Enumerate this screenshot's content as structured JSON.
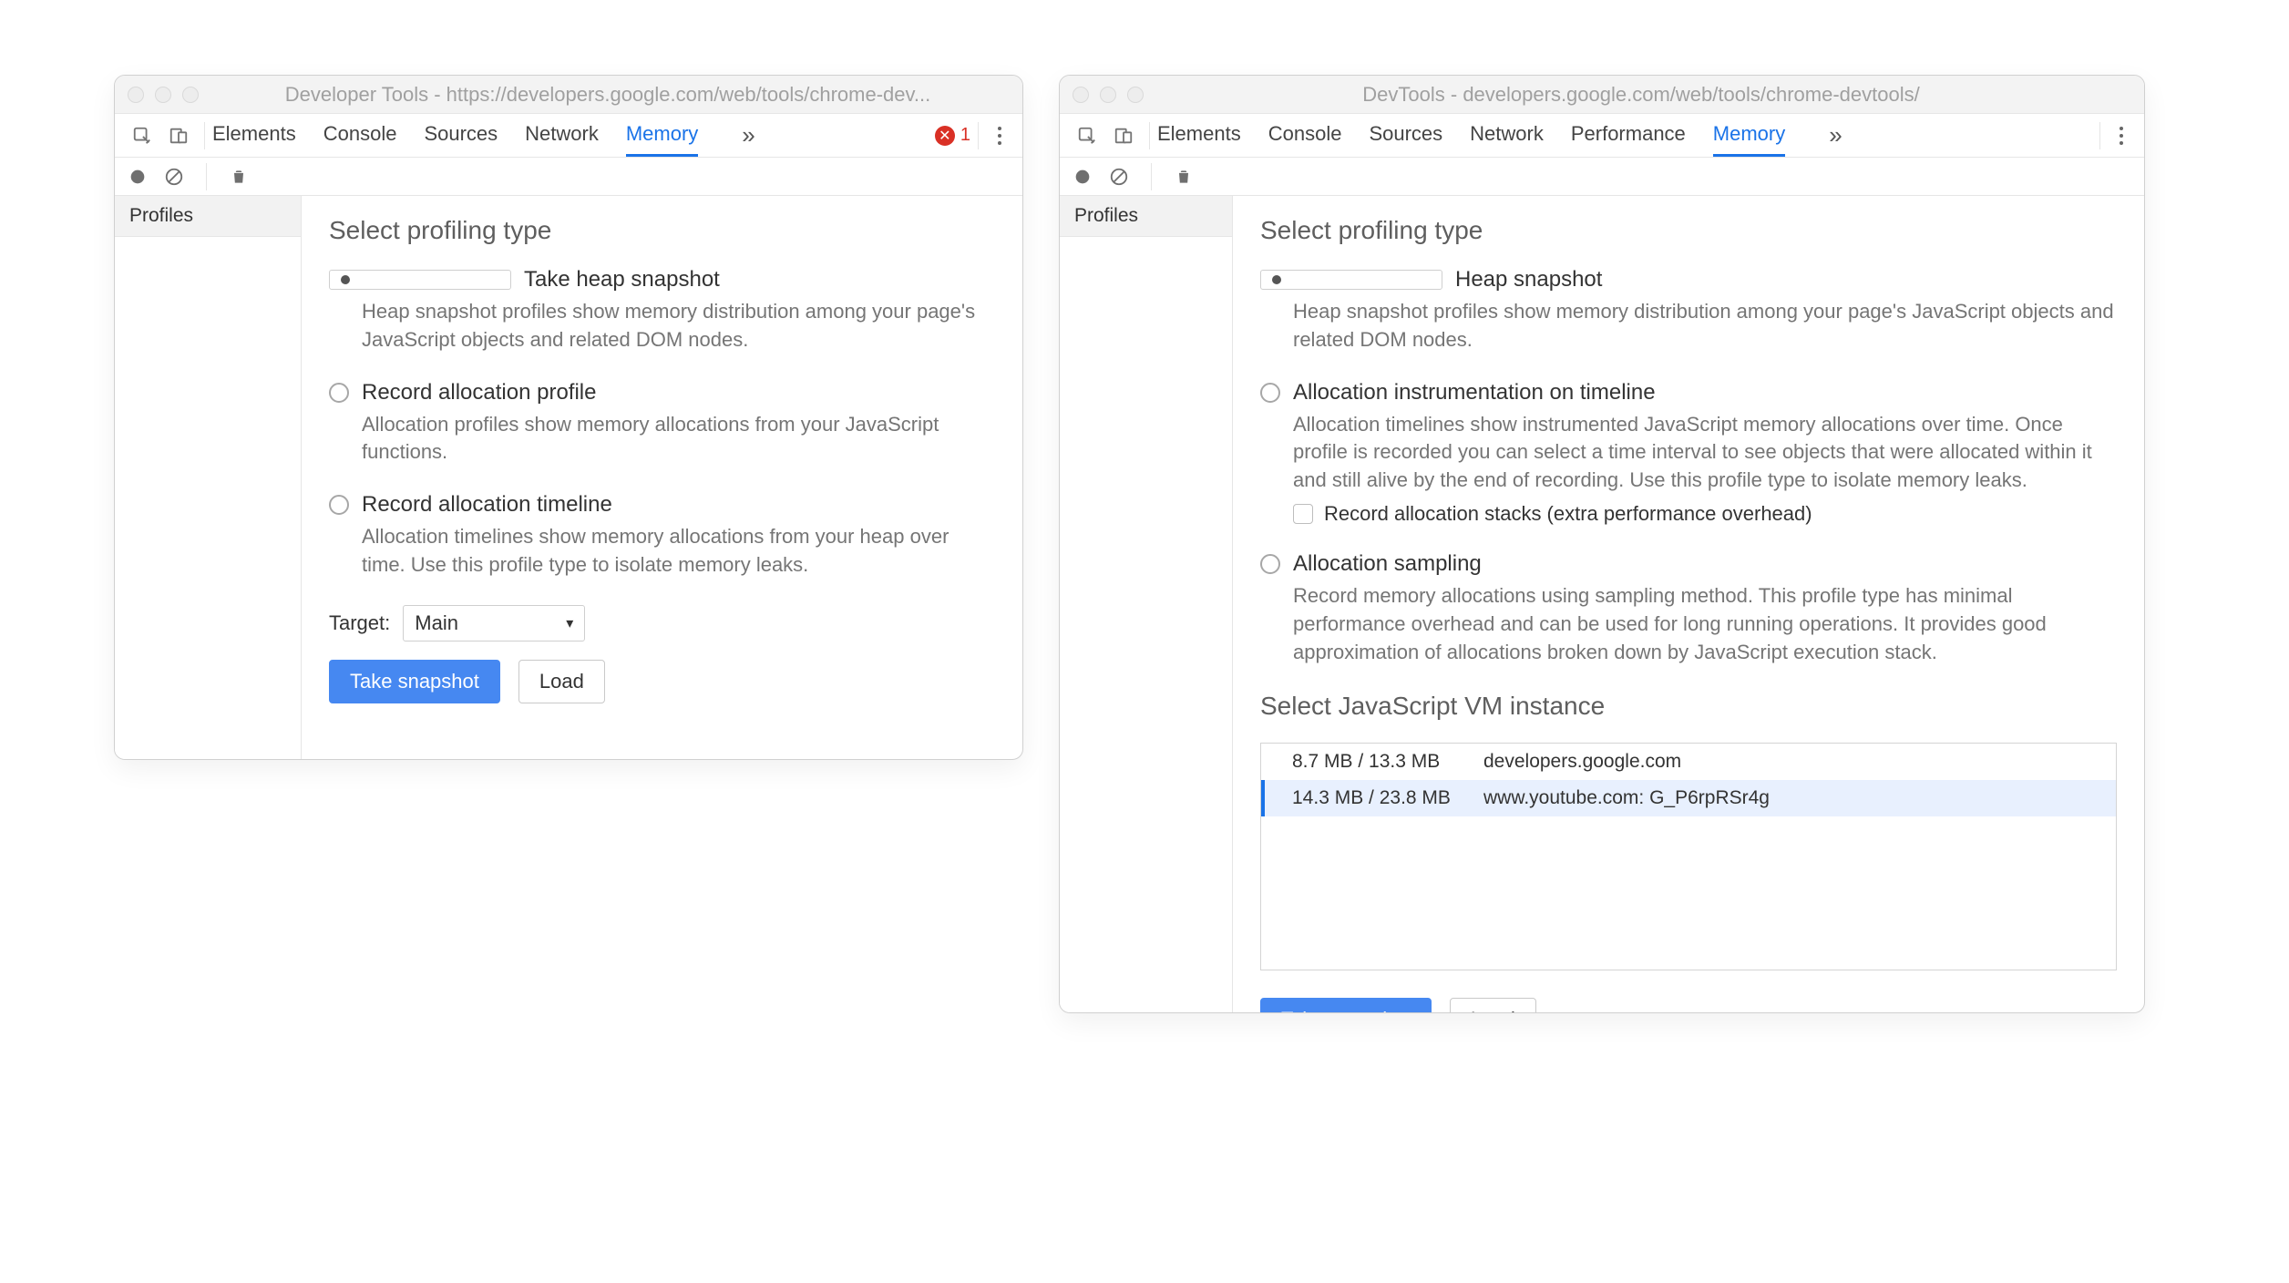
{
  "general": {
    "profiles_label": "Profiles",
    "heading": "Select profiling type",
    "take_snapshot": "Take snapshot",
    "load": "Load"
  },
  "left": {
    "title": "Developer Tools - https://developers.google.com/web/tools/chrome-dev...",
    "tabs": [
      "Elements",
      "Console",
      "Sources",
      "Network",
      "Memory"
    ],
    "active_tab": "Memory",
    "error_count": "1",
    "options": [
      {
        "label": "Take heap snapshot",
        "desc": "Heap snapshot profiles show memory distribution among your page's JavaScript objects and related DOM nodes.",
        "selected": true
      },
      {
        "label": "Record allocation profile",
        "desc": "Allocation profiles show memory allocations from your JavaScript functions.",
        "selected": false
      },
      {
        "label": "Record allocation timeline",
        "desc": "Allocation timelines show memory allocations from your heap over time. Use this profile type to isolate memory leaks.",
        "selected": false
      }
    ],
    "target_label": "Target:",
    "target_value": "Main"
  },
  "right": {
    "title": "DevTools - developers.google.com/web/tools/chrome-devtools/",
    "tabs": [
      "Elements",
      "Console",
      "Sources",
      "Network",
      "Performance",
      "Memory"
    ],
    "active_tab": "Memory",
    "options": [
      {
        "label": "Heap snapshot",
        "desc": "Heap snapshot profiles show memory distribution among your page's JavaScript objects and related DOM nodes.",
        "selected": true
      },
      {
        "label": "Allocation instrumentation on timeline",
        "desc": "Allocation timelines show instrumented JavaScript memory allocations over time. Once profile is recorded you can select a time interval to see objects that were allocated within it and still alive by the end of recording. Use this profile type to isolate memory leaks.",
        "selected": false,
        "suboption_label": "Record allocation stacks (extra performance overhead)"
      },
      {
        "label": "Allocation sampling",
        "desc": "Record memory allocations using sampling method. This profile type has minimal performance overhead and can be used for long running operations. It provides good approximation of allocations broken down by JavaScript execution stack.",
        "selected": false
      }
    ],
    "vm_heading": "Select JavaScript VM instance",
    "vm": [
      {
        "size": "8.7 MB / 13.3 MB",
        "name": "developers.google.com",
        "selected": false
      },
      {
        "size": "14.3 MB / 23.8 MB",
        "name": "www.youtube.com: G_P6rpRSr4g",
        "selected": true
      }
    ]
  }
}
